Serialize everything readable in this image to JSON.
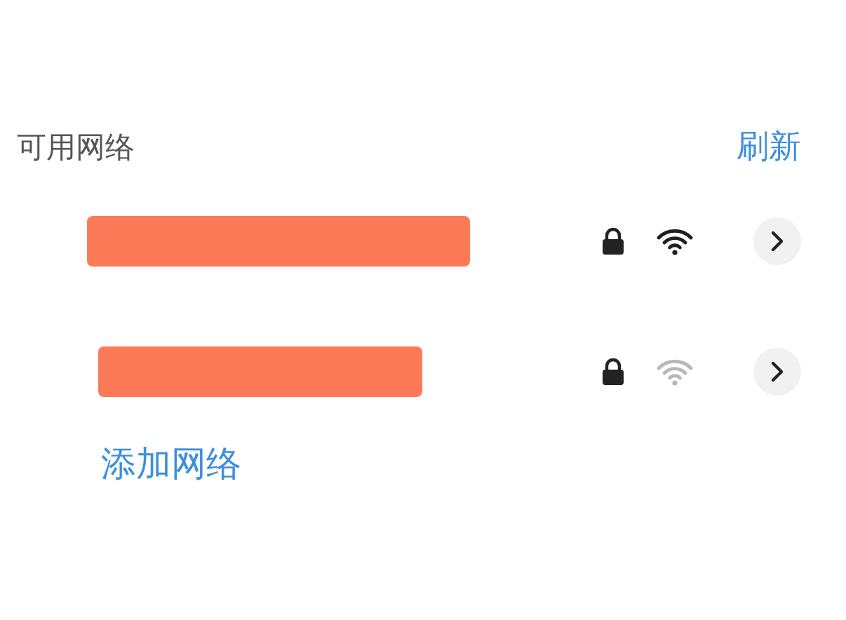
{
  "header": {
    "title": "可用网络",
    "refresh": "刷新"
  },
  "networks": [
    {
      "name_redacted": true,
      "locked": true,
      "signal_strong": true
    },
    {
      "name_redacted": true,
      "locked": true,
      "signal_strong": false
    }
  ],
  "add_network": "添加网络"
}
